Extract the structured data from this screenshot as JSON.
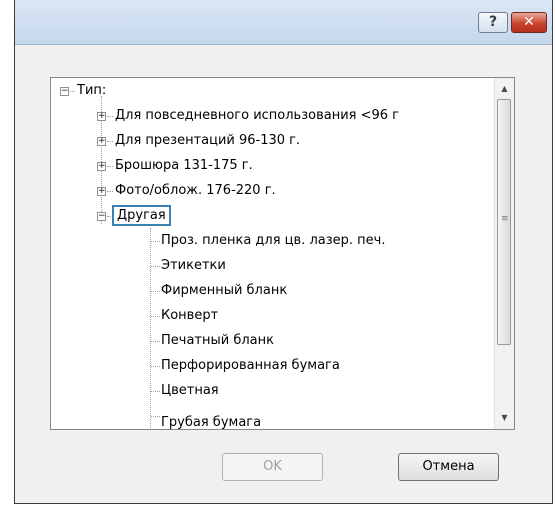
{
  "titlebar": {
    "help_glyph": "?",
    "close_glyph": "✕"
  },
  "tree": {
    "root_label": "Тип:",
    "categories": [
      {
        "label": "Для повседневного использования <96 г",
        "expanded": false
      },
      {
        "label": "Для презентаций 96-130 г.",
        "expanded": false
      },
      {
        "label": "Брошюра 131-175 г.",
        "expanded": false
      },
      {
        "label": "Фото/облож. 176-220 г.",
        "expanded": false
      },
      {
        "label": "Другая",
        "expanded": true,
        "selected": true
      }
    ],
    "children": [
      "Проз. пленка для цв. лазер. печ.",
      "Этикетки",
      "Фирменный бланк",
      "Конверт",
      "Печатный бланк",
      "Перфорированная бумага",
      "Цветная",
      "Грубая бумага"
    ],
    "expand_glyph": "+",
    "collapse_glyph": "−"
  },
  "buttons": {
    "ok_label": "OK",
    "cancel_label": "Отмена"
  },
  "colors": {
    "selection_outline": "#3c7fb1",
    "close_button": "#c9432c"
  }
}
